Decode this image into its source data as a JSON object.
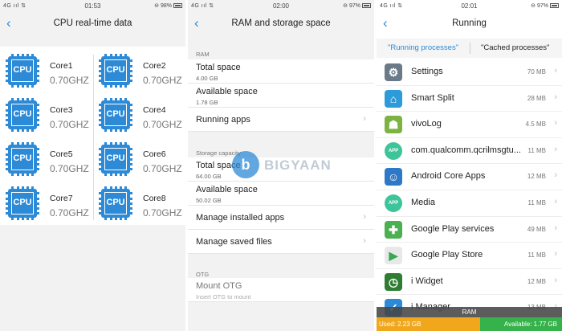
{
  "panel1": {
    "status": {
      "left": "4G ııl  ⇅",
      "time": "01:53",
      "right": "⊖ 98%"
    },
    "title": "CPU real-time data",
    "chip_label": "CPU",
    "cores": [
      {
        "name": "Core1",
        "freq": "0.70GHZ"
      },
      {
        "name": "Core2",
        "freq": "0.70GHZ"
      },
      {
        "name": "Core3",
        "freq": "0.70GHZ"
      },
      {
        "name": "Core4",
        "freq": "0.70GHZ"
      },
      {
        "name": "Core5",
        "freq": "0.70GHZ"
      },
      {
        "name": "Core6",
        "freq": "0.70GHZ"
      },
      {
        "name": "Core7",
        "freq": "0.70GHZ"
      },
      {
        "name": "Core8",
        "freq": "0.70GHZ"
      }
    ]
  },
  "panel2": {
    "status": {
      "left": "4G ııl  ⇅",
      "time": "02:00",
      "right": "⊖ 97%"
    },
    "title": "RAM and storage space",
    "ram_label": "RAM",
    "ram_total_label": "Total space",
    "ram_total_value": "4.00 GB",
    "ram_avail_label": "Available space",
    "ram_avail_value": "1.78 GB",
    "running_apps": "Running apps",
    "storage_label": "Storage capacity",
    "storage_total_label": "Total space",
    "storage_total_value": "64.00 GB",
    "storage_avail_label": "Available space",
    "storage_avail_value": "50.02 GB",
    "manage_installed": "Manage installed apps",
    "manage_saved": "Manage saved files",
    "otg_label": "OTG",
    "mount_otg": "Mount OTG",
    "mount_otg_sub": "Insert OTG to mount",
    "watermark_letter": "b",
    "watermark_text": "BIGYAAN"
  },
  "panel3": {
    "status": {
      "left": "4G ııl  ⇅",
      "time": "02:01",
      "right": "⊖ 97%"
    },
    "title": "Running",
    "tab_running": "\"Running processes\"",
    "tab_cached": "\"Cached processes\"",
    "apps": [
      {
        "name": "Settings",
        "size": "70 MB",
        "icon": "gear-icon",
        "color": "#6b7a88",
        "glyph": "⚙"
      },
      {
        "name": "Smart Split",
        "size": "28 MB",
        "icon": "house-icon",
        "color": "#2d9bd9",
        "glyph": "⌂"
      },
      {
        "name": "vivoLog",
        "size": "4.5 MB",
        "icon": "android-icon",
        "color": "#7cb342",
        "glyph": "☗"
      },
      {
        "name": "com.qualcomm.qcrilmsgtu...",
        "size": "11 MB",
        "icon": "app-icon",
        "color": "#3ec49a",
        "glyph": "APP"
      },
      {
        "name": "Android Core Apps",
        "size": "12 MB",
        "icon": "person-icon",
        "color": "#2d79c8",
        "glyph": "☺"
      },
      {
        "name": "Media",
        "size": "11 MB",
        "icon": "app-icon",
        "color": "#3ec49a",
        "glyph": "APP"
      },
      {
        "name": "Google Play services",
        "size": "49 MB",
        "icon": "puzzle-icon",
        "color": "#4caf50",
        "glyph": "✚"
      },
      {
        "name": "Google Play Store",
        "size": "11 MB",
        "icon": "play-store-icon",
        "color": "#e8e8e8",
        "glyph": "▶"
      },
      {
        "name": "i Widget",
        "size": "12 MB",
        "icon": "clock-icon",
        "color": "#2e7d32",
        "glyph": "◷"
      },
      {
        "name": "i Manager",
        "size": "13 MB",
        "icon": "shield-icon",
        "color": "#2d8ad6",
        "glyph": "✓"
      }
    ],
    "ram_bar_label": "RAM",
    "ram_used": "Used: 2.23 GB",
    "ram_available": "Available: 1.77 GB",
    "ram_used_fraction": 0.557,
    "used_color": "#f0a71c",
    "available_color": "#35b24a"
  }
}
